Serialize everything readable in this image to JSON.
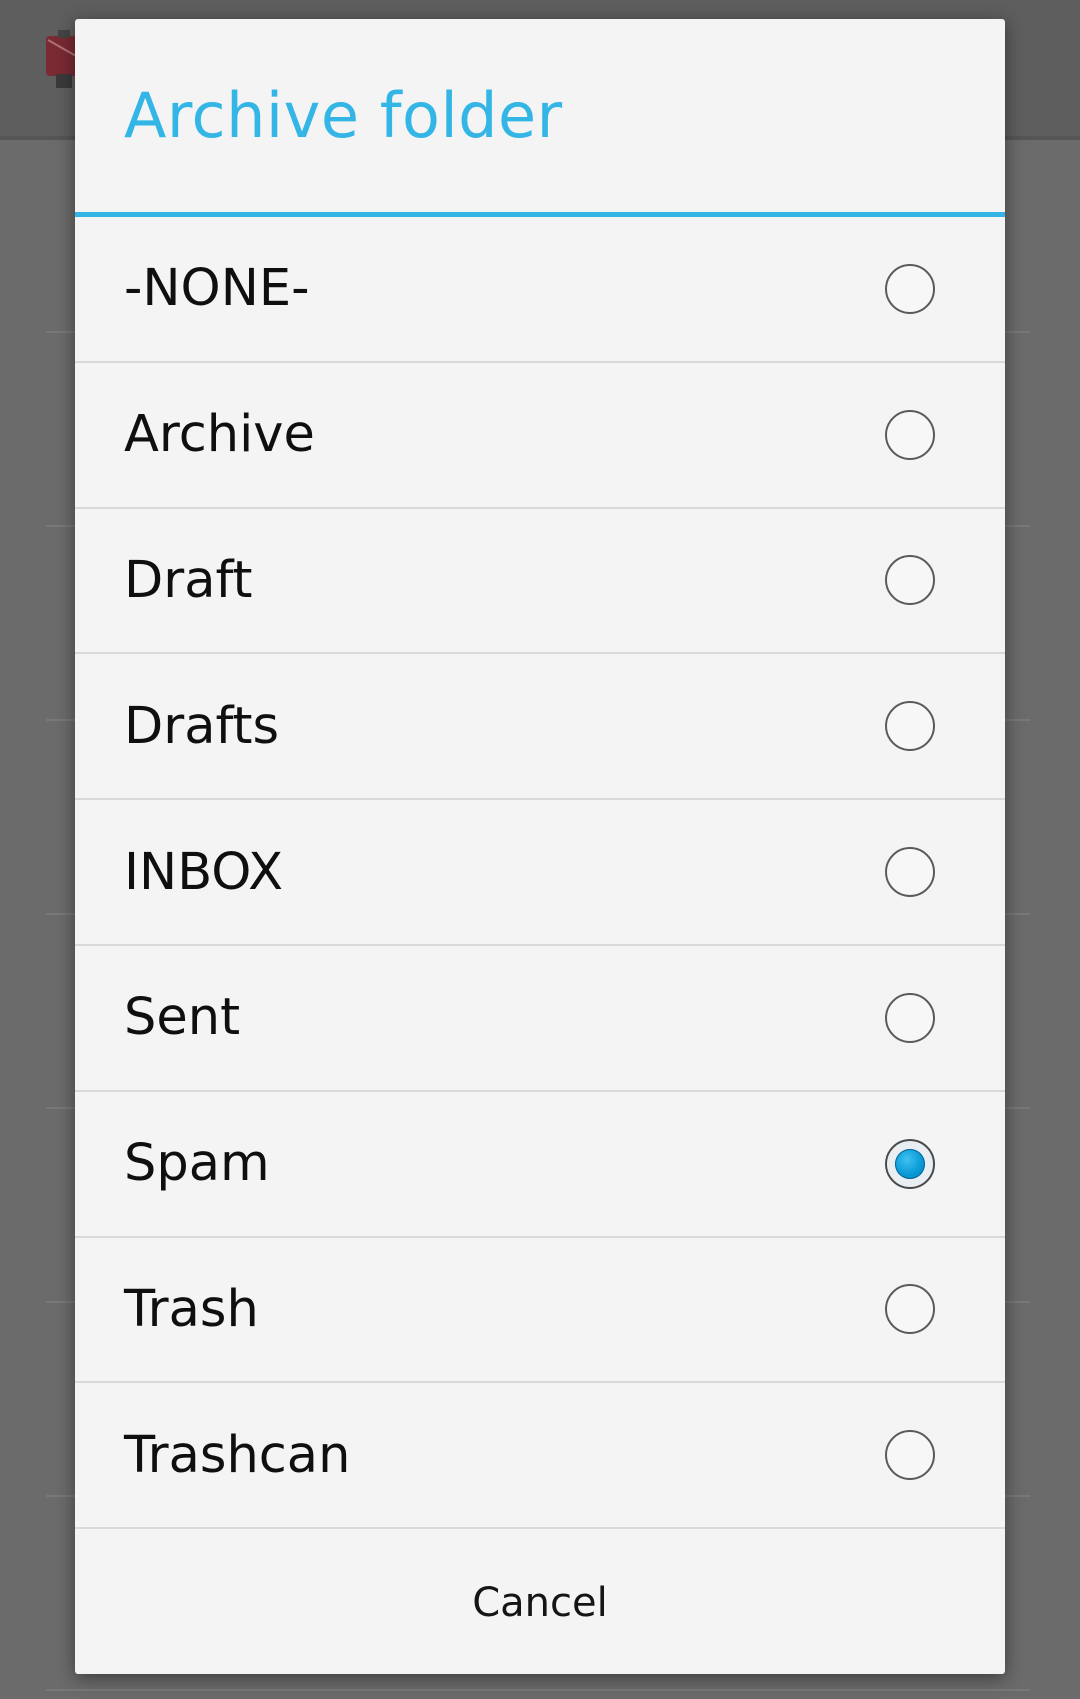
{
  "dialog": {
    "title": "Archive folder",
    "options": [
      {
        "label": "-NONE-",
        "checked": false
      },
      {
        "label": "Archive",
        "checked": false
      },
      {
        "label": "Draft",
        "checked": false
      },
      {
        "label": "Drafts",
        "checked": false
      },
      {
        "label": "INBOX",
        "checked": false
      },
      {
        "label": "Sent",
        "checked": false
      },
      {
        "label": "Spam",
        "checked": true
      },
      {
        "label": "Trash",
        "checked": false
      },
      {
        "label": "Trashcan",
        "checked": false
      }
    ],
    "cancel_label": "Cancel"
  },
  "colors": {
    "accent": "#33b5e5",
    "dialog_background": "#f4f4f4",
    "scrim": "#6b6b6b",
    "divider": "#d9d9d9"
  },
  "icons": {
    "app_logo": "app-logo-icon"
  }
}
